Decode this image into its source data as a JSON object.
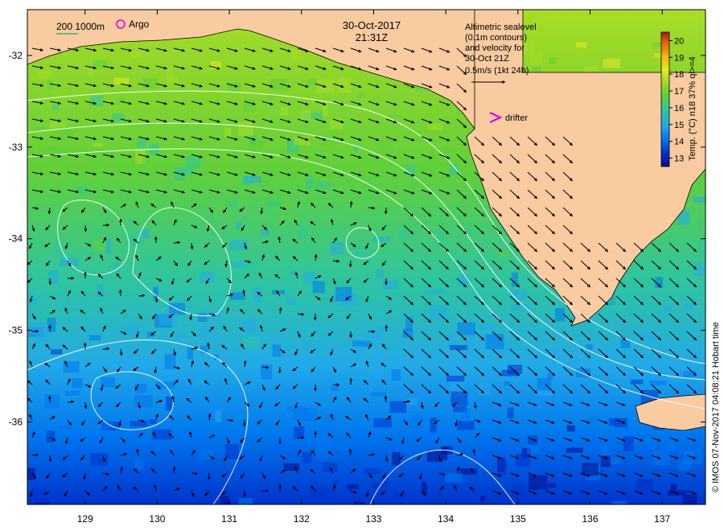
{
  "header": {
    "date": "30-Oct-2017",
    "time": "21:31Z"
  },
  "legend": {
    "depth_contour_label": "200  1000m",
    "argo_label": "Argo",
    "drifter_label": "drifter",
    "depth_contour_color": "#3cb371",
    "argo_color": "#e000e0",
    "drifter_color": "#e000e0"
  },
  "info": {
    "lines": [
      "Altimetric sealevel",
      "(0.1m contours)",
      "and velocity for",
      "30-Oct 21Z",
      "0.5m/s (1kt 24h)"
    ]
  },
  "colorbar": {
    "title": "Temp. (°C) n18 37% ql>=4",
    "ticks": [
      "13",
      "14",
      "15",
      "16",
      "17",
      "18",
      "19",
      "20"
    ],
    "min": 12.5,
    "max": 20.5,
    "colors": [
      "#0a0a8c",
      "#0033cc",
      "#0077ee",
      "#22a9e8",
      "#2ec4a0",
      "#5fd03c",
      "#a8dd28",
      "#e8e81e",
      "#f2b414",
      "#e8640c",
      "#a81808"
    ]
  },
  "axes": {
    "x_ticks": [
      "129",
      "130",
      "131",
      "132",
      "133",
      "134",
      "135",
      "136",
      "137"
    ],
    "y_ticks": [
      "-32",
      "-33",
      "-34",
      "-35",
      "-36"
    ],
    "lon_range": [
      128.2,
      137.6
    ],
    "lat_range": [
      -36.9,
      -31.5
    ]
  },
  "credit": "© IMOS 07-Nov-2017 04:08:21 Hobart time",
  "colors": {
    "land": "#f9cba0",
    "contour": "#ffffff",
    "arrow": "#000000"
  }
}
